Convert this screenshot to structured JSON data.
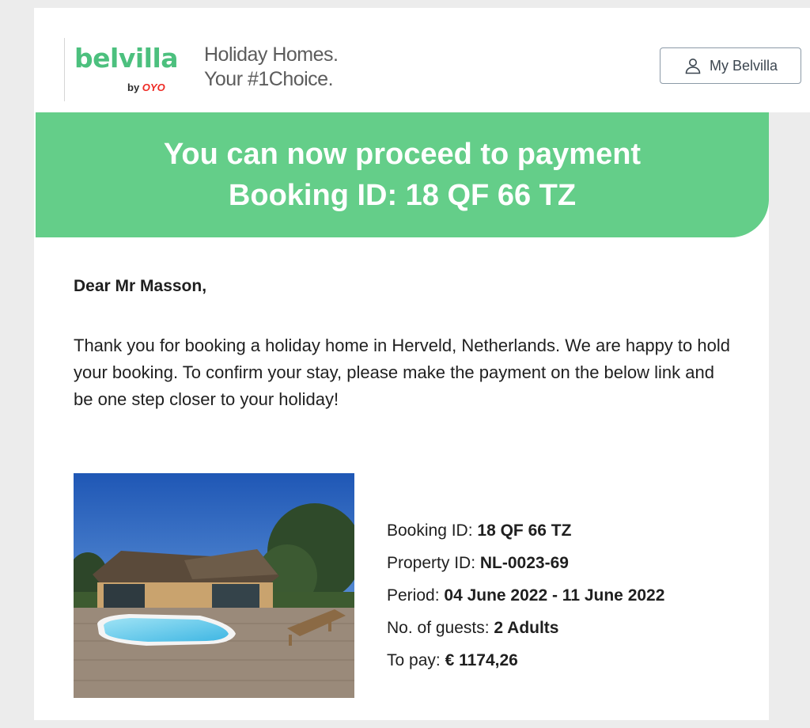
{
  "header": {
    "logo_text": "belvilla",
    "logo_by": "by",
    "logo_oyo": "OYO",
    "tagline_line1": "Holiday Homes.",
    "tagline_line2": "Your #1Choice.",
    "account_button_label": "My Belvilla"
  },
  "banner": {
    "line1": "You can now proceed to payment",
    "line2": "Booking ID: 18 QF 66 TZ"
  },
  "body": {
    "greeting": "Dear Mr Masson,",
    "intro": "Thank you for booking a holiday home in Herveld, Netherlands. We are happy to hold your booking. To confirm your stay, please make the payment on the below link and be one step closer to your holiday!"
  },
  "booking": {
    "booking_id_label": "Booking ID:",
    "booking_id_value": "18 QF 66 TZ",
    "property_id_label": "Property ID:",
    "property_id_value": "NL-0023-69",
    "period_label": "Period:",
    "period_value": "04 June 2022 - 11 June 2022",
    "guests_label": "No. of guests:",
    "guests_value": "2 Adults",
    "to_pay_label": "To pay:",
    "to_pay_value": "€ 1174,26"
  },
  "icons": {
    "account": "user-icon"
  },
  "colors": {
    "brand_green": "#64ce89",
    "logo_green": "#4cc07e",
    "oyo_red": "#ee2a24"
  }
}
